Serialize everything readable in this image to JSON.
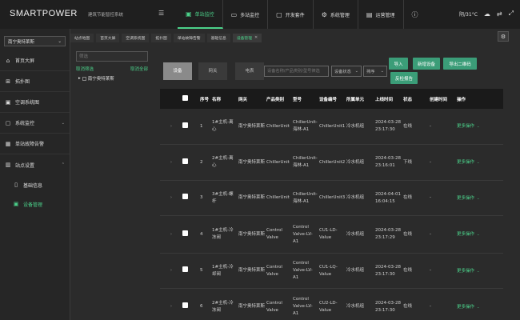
{
  "header": {
    "logo": "SMARTPOWER",
    "subtitle": "建筑节能智控系统",
    "nav": [
      {
        "label": "单站监控",
        "icon": "monitor-icon",
        "active": true
      },
      {
        "label": "多站监控",
        "icon": "display-icon",
        "active": false
      },
      {
        "label": "开发套件",
        "icon": "code-icon",
        "active": false
      },
      {
        "label": "系统管理",
        "icon": "gear-icon",
        "active": false
      },
      {
        "label": "运营管理",
        "icon": "clipboard-icon",
        "active": false
      }
    ],
    "weather": "阴/31°C"
  },
  "sidebar": {
    "site": "南宁奥特莱斯",
    "items": [
      {
        "label": "首页大屏",
        "icon": "home-icon",
        "has_children": false
      },
      {
        "label": "拓扑图",
        "icon": "topology-icon",
        "has_children": false
      },
      {
        "label": "空调系统图",
        "icon": "aircon-icon",
        "has_children": false
      },
      {
        "label": "系统监控",
        "icon": "monitor-icon",
        "has_children": true
      },
      {
        "label": "单站故障告警",
        "icon": "alarm-icon",
        "has_children": false
      },
      {
        "label": "站点设置",
        "icon": "site-icon",
        "has_children": true
      }
    ],
    "subitems": [
      {
        "label": "基础信息",
        "icon": "doc-icon",
        "active": false
      },
      {
        "label": "设备管理",
        "icon": "device-icon",
        "active": true
      }
    ]
  },
  "tabs": [
    {
      "label": "站点地图",
      "active": false,
      "closable": false
    },
    {
      "label": "首页大屏",
      "active": false,
      "closable": false
    },
    {
      "label": "空调系统图",
      "active": false,
      "closable": false
    },
    {
      "label": "拓扑图",
      "active": false,
      "closable": false
    },
    {
      "label": "单站故障告警",
      "active": false,
      "closable": false
    },
    {
      "label": "基础信息",
      "active": false,
      "closable": false
    },
    {
      "label": "设备管理",
      "active": true,
      "closable": true
    }
  ],
  "tree": {
    "filter_placeholder": "筛选",
    "cancel_filter": "取消筛选",
    "cancel_all": "取消全部",
    "root": "南宁奥特莱斯"
  },
  "toolbar": {
    "type_tabs": [
      "设备",
      "网关",
      "电表"
    ],
    "search_placeholder": "设备名称/产品类别/型号筛选",
    "status_placeholder": "设备状态",
    "sort_label": "排序",
    "buttons": [
      "导入",
      "新增设备",
      "导出二维码",
      "反检报告"
    ]
  },
  "table": {
    "headers": [
      "",
      "序号",
      "名称",
      "网关",
      "产品类别",
      "型号",
      "设备编号",
      "所属单元",
      "上线时间",
      "状态",
      "创建时间",
      "操作"
    ],
    "rows": [
      {
        "index": "1",
        "name": "1#主机-离心",
        "gateway": "南宁奥特莱斯",
        "category": "ChillerUnit",
        "model": "ChillerUnit-海林-A1",
        "code": "ChillerUnit1",
        "unit": "冷水机组",
        "online": "2024-03-28 23:17:30",
        "status": "在线",
        "created": "-",
        "action": "更多操作"
      },
      {
        "index": "2",
        "name": "2#主机-离心",
        "gateway": "南宁奥特莱斯",
        "category": "ChillerUnit",
        "model": "ChillerUnit-海林-A1",
        "code": "ChillerUnit2",
        "unit": "冷水机组",
        "online": "2024-03-28 23:16:01",
        "status": "下线",
        "created": "-",
        "action": "更多操作"
      },
      {
        "index": "3",
        "name": "3#主机-螺杆",
        "gateway": "南宁奥特莱斯",
        "category": "ChillerUnit",
        "model": "ChillerUnit-海林-A1",
        "code": "ChillerUnit3",
        "unit": "冷水机组",
        "online": "2024-04-01 16:04:15",
        "status": "在线",
        "created": "-",
        "action": "更多操作"
      },
      {
        "index": "4",
        "name": "1#主机-冷冻阀",
        "gateway": "南宁奥特莱斯",
        "category": "Control Valve",
        "model": "Control Valve-LV-A1",
        "code": "CU1-LD-Value",
        "unit": "冷水机组",
        "online": "2024-03-28 23:17:29",
        "status": "在线",
        "created": "-",
        "action": "更多操作"
      },
      {
        "index": "5",
        "name": "1#主机-冷却阀",
        "gateway": "南宁奥特莱斯",
        "category": "Control Valve",
        "model": "Control Valve-LV-A1",
        "code": "CU1-LQ-Value",
        "unit": "冷水机组",
        "online": "2024-03-28 23:17:30",
        "status": "在线",
        "created": "-",
        "action": "更多操作"
      },
      {
        "index": "6",
        "name": "2#主机-冷冻阀",
        "gateway": "南宁奥特莱斯",
        "category": "Control Valve",
        "model": "Control Valve-LV-A1",
        "code": "CU2-LD-Value",
        "unit": "冷水机组",
        "online": "2024-03-28 23:17:30",
        "status": "在线",
        "created": "-",
        "action": "更多操作"
      }
    ]
  }
}
